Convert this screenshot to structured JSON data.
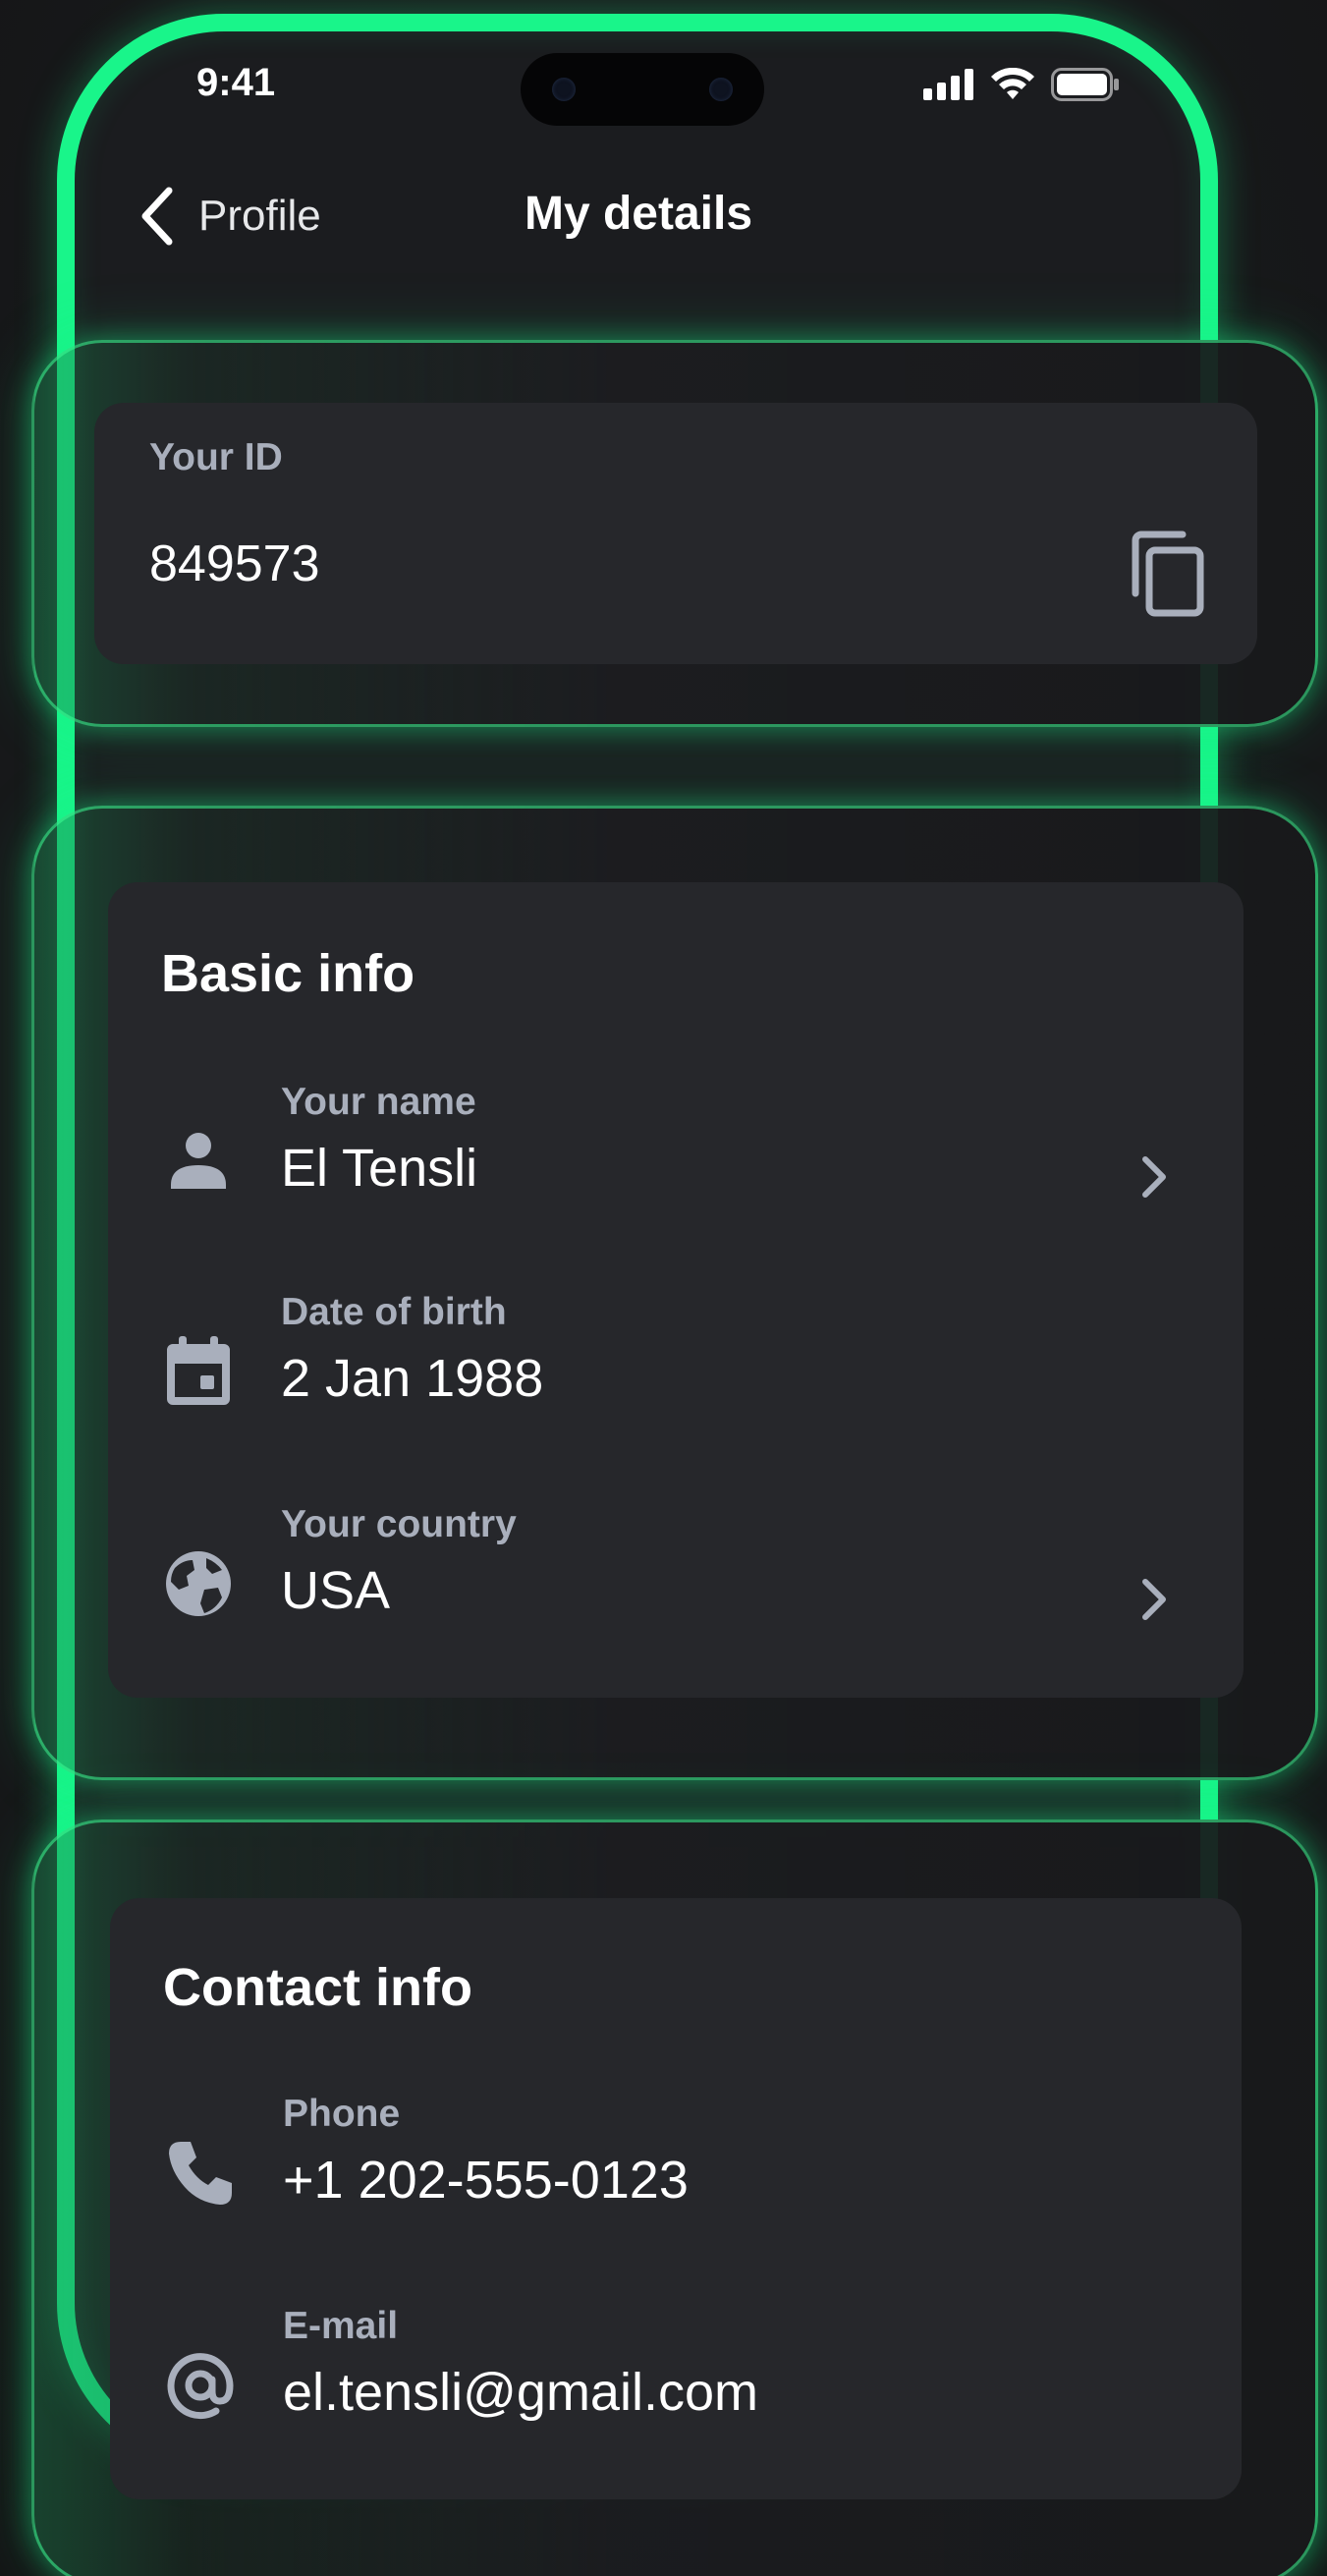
{
  "status_bar": {
    "time": "9:41",
    "icons": [
      "cellular-signal-icon",
      "wifi-icon",
      "battery-icon"
    ]
  },
  "nav": {
    "back_label": "Profile",
    "title": "My details"
  },
  "id_card": {
    "label": "Your ID",
    "value": "849573",
    "action_icon": "copy-icon"
  },
  "basic_info": {
    "title": "Basic info",
    "items": [
      {
        "icon": "person-icon",
        "label": "Your name",
        "value": "El Tensli",
        "has_chevron": true
      },
      {
        "icon": "calendar-icon",
        "label": "Date of birth",
        "value": "2 Jan 1988",
        "has_chevron": false
      },
      {
        "icon": "globe-icon",
        "label": "Your country",
        "value": "USA",
        "has_chevron": true
      }
    ]
  },
  "contact_info": {
    "title": "Contact info",
    "items": [
      {
        "icon": "phone-icon",
        "label": "Phone",
        "value": "+1 202-555-0123"
      },
      {
        "icon": "at-sign-icon",
        "label": "E-mail",
        "value": "el.tensli@gmail.com"
      }
    ]
  },
  "colors": {
    "accent": "#19f58a",
    "background": "#191a1c",
    "card": "#26272b",
    "label": "#a9afbc",
    "text": "#ffffff"
  }
}
